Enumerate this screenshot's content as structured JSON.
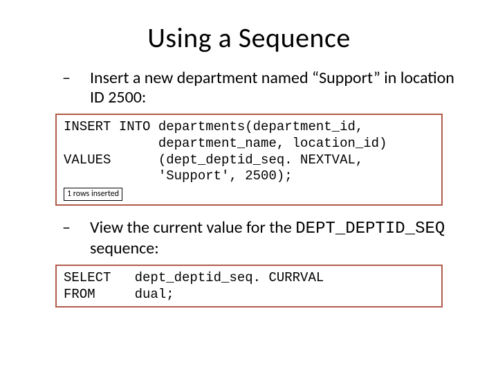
{
  "title": "Using a Sequence",
  "bullets": {
    "b1_prefix": "– ",
    "b1_text": "Insert a new department named “Support” in location ID 2500:",
    "b2_prefix": "– ",
    "b2_text_before": "View the current value for the ",
    "b2_code": "DEPT_DEPTID_SEQ",
    "b2_text_after": " sequence:"
  },
  "code1": {
    "line1": "INSERT INTO departments(department_id,",
    "line2": "            department_name, location_id)",
    "line3": "VALUES      (dept_deptid_seq. NEXTVAL,",
    "line4": "            'Support', 2500);",
    "result": "1 rows inserted"
  },
  "code2": {
    "line1": "SELECT   dept_deptid_seq. CURRVAL",
    "line2": "FROM     dual;"
  }
}
